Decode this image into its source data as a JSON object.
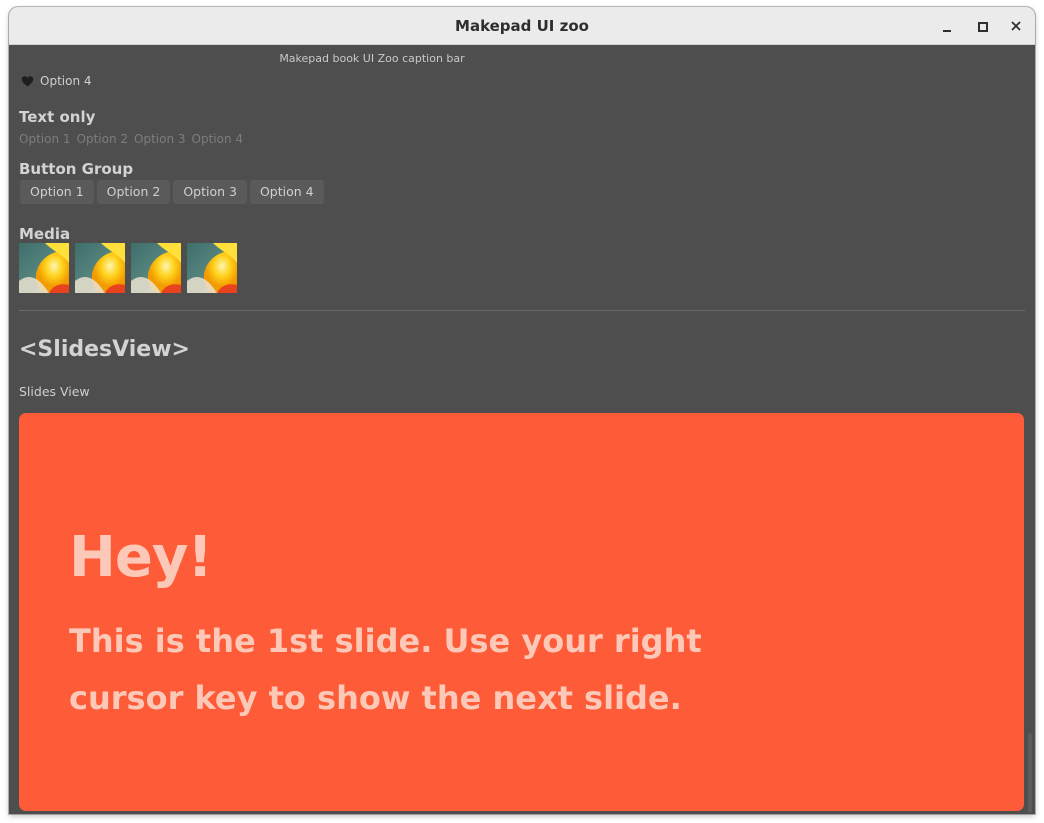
{
  "window": {
    "title": "Makepad UI zoo",
    "controls": {
      "minimize": "minimize",
      "maximize": "maximize",
      "close": "close"
    }
  },
  "caption_bar": {
    "text": "Makepad book UI Zoo caption bar"
  },
  "radio_icon_item": {
    "icon": "heart-icon",
    "label": "Option 4"
  },
  "text_only": {
    "title": "Text only",
    "options": [
      "Option 1",
      "Option 2",
      "Option 3",
      "Option 4"
    ]
  },
  "button_group": {
    "title": "Button Group",
    "options": [
      "Option 1",
      "Option 2",
      "Option 3",
      "Option 4"
    ]
  },
  "media": {
    "title": "Media",
    "thumbnails": [
      "media-thumbnail",
      "media-thumbnail",
      "media-thumbnail",
      "media-thumbnail"
    ]
  },
  "slides": {
    "heading": "<SlidesView>",
    "subtitle": "Slides View",
    "current_slide": {
      "title": "Hey!",
      "body": "This is the 1st slide. Use your right cursor key to show the next slide."
    }
  },
  "colors": {
    "background": "#4e4e4e",
    "slide_bg": "#fe5b38",
    "slide_text": "#fcc9b8",
    "titlebar": "#ebebeb"
  }
}
